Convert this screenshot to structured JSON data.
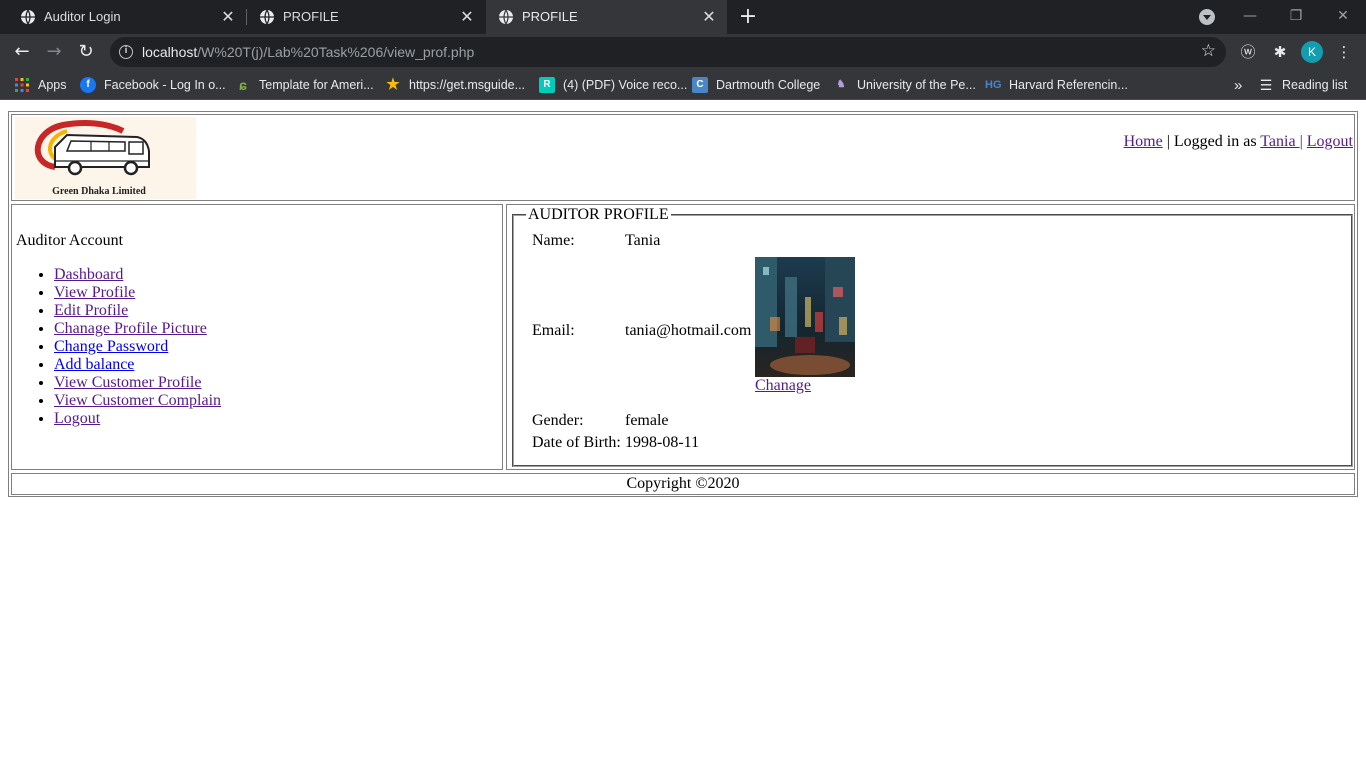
{
  "browser": {
    "tabs": [
      {
        "title": "Auditor Login",
        "active": false
      },
      {
        "title": "PROFILE",
        "active": false
      },
      {
        "title": "PROFILE",
        "active": true
      }
    ],
    "url_host": "localhost",
    "url_path": "/W%20T(j)/Lab%20Task%206/view_prof.php",
    "profile_initial": "K",
    "bookmarks": [
      {
        "label": "Apps",
        "icon": "apps-grid-icon"
      },
      {
        "label": "Facebook - Log In o...",
        "icon": "facebook-icon"
      },
      {
        "label": "Template for Ameri...",
        "icon": "template-icon"
      },
      {
        "label": "https://get.msguide...",
        "icon": "star-icon"
      },
      {
        "label": "(4) (PDF) Voice reco...",
        "icon": "researchgate-icon"
      },
      {
        "label": "Dartmouth College",
        "icon": "dartmouth-icon"
      },
      {
        "label": "University of the Pe...",
        "icon": "university-icon"
      },
      {
        "label": "Harvard Referencin...",
        "icon": "harvard-icon"
      }
    ],
    "more_bookmarks": "»",
    "reading_list": "Reading list"
  },
  "header": {
    "logo_caption": "Green Dhaka Limited",
    "nav": {
      "home": "Home",
      "sep1": " | Logged in as ",
      "user": "Tania ",
      "sep2": "| ",
      "logout": "Logout"
    }
  },
  "sidebar": {
    "title": "Auditor Account",
    "items": [
      {
        "label": "Dashboard"
      },
      {
        "label": "View Profile"
      },
      {
        "label": "Edit Profile"
      },
      {
        "label": "Chanage Profile Picture"
      },
      {
        "label": "Change Password"
      },
      {
        "label": "Add balance"
      },
      {
        "label": "View Customer Profile"
      },
      {
        "label": "View Customer Complain"
      },
      {
        "label": "Logout"
      }
    ]
  },
  "profile": {
    "legend": "AUDITOR PROFILE",
    "name_label": "Name:",
    "name": "Tania",
    "email_label": "Email:",
    "email": "tania@hotmail.com",
    "change_link": "Chanage",
    "gender_label": "Gender:",
    "gender": "female",
    "dob_label": "Date of Birth:",
    "dob": "1998-08-11"
  },
  "footer": {
    "copyright": "Copyright ©2020"
  }
}
